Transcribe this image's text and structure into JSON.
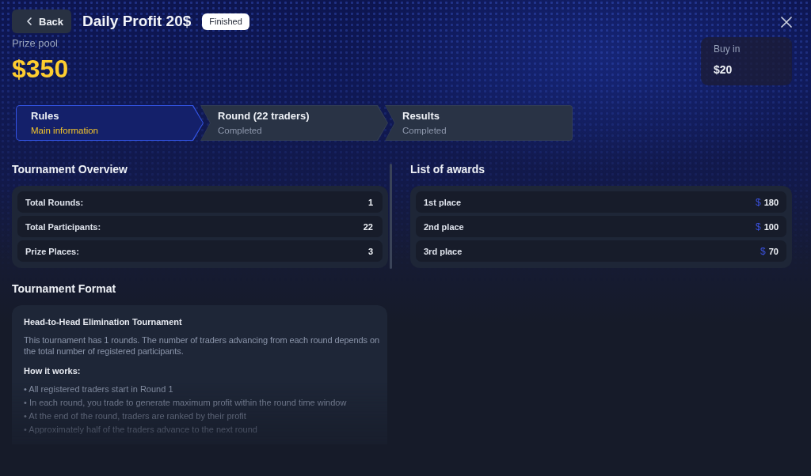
{
  "header": {
    "back_button": "Back",
    "title": "Daily Profit 20$",
    "status_badge": "Finished"
  },
  "prize_pool": {
    "label": "Prize pool",
    "amount": "$350"
  },
  "buy_in": {
    "label": "Buy in",
    "amount": "$20"
  },
  "steps": [
    {
      "title": "Rules",
      "subtitle": "Main information",
      "selected": true
    },
    {
      "title": "Round (22 traders)",
      "subtitle": "Completed",
      "selected": false
    },
    {
      "title": "Results",
      "subtitle": "Completed",
      "selected": false
    }
  ],
  "overview": {
    "title": "Tournament Overview",
    "rows": [
      {
        "label": "Total Rounds:",
        "value": "1"
      },
      {
        "label": "Total Participants:",
        "value": "22"
      },
      {
        "label": "Prize Places:",
        "value": "3"
      }
    ]
  },
  "awards": {
    "title": "List of awards",
    "rows": [
      {
        "place": "1st place",
        "currency": "$",
        "amount": "180"
      },
      {
        "place": "2nd place",
        "currency": "$",
        "amount": "100"
      },
      {
        "place": "3rd place",
        "currency": "$",
        "amount": "70"
      }
    ]
  },
  "format": {
    "title": "Tournament Format",
    "heading": "Head-to-Head Elimination Tournament",
    "description": "This tournament has 1 rounds. The number of traders advancing from each round depends on the total number of registered participants.",
    "subheading": "How it works:",
    "bullets": [
      "• All registered traders start in Round 1",
      "• In each round, you trade to generate maximum profit within the round time window",
      "• At the end of the round, traders are ranked by their profit",
      "• Approximately half of the traders advance to the next round"
    ]
  }
}
